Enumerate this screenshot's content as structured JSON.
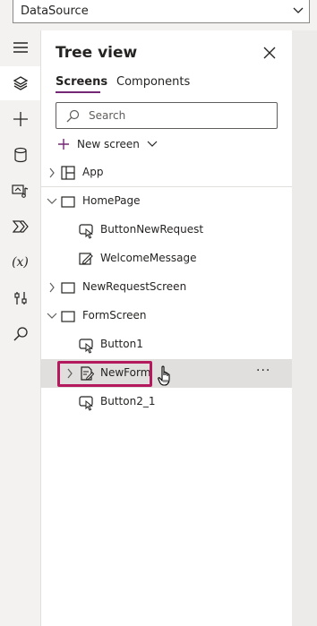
{
  "datasource": {
    "label": "DataSource"
  },
  "rail": {
    "items": [
      {
        "icon": "hamburger-menu-icon"
      },
      {
        "icon": "layers-icon",
        "active": true
      },
      {
        "icon": "plus-icon"
      },
      {
        "icon": "database-icon"
      },
      {
        "icon": "media-icon"
      },
      {
        "icon": "power-automate-icon"
      },
      {
        "icon": "variables-icon"
      },
      {
        "icon": "advanced-tools-icon"
      },
      {
        "icon": "search-icon"
      }
    ],
    "variables_label": "(x)"
  },
  "panel": {
    "title": "Tree view",
    "tabs": [
      {
        "label": "Screens",
        "active": true
      },
      {
        "label": "Components",
        "active": false
      }
    ],
    "search_placeholder": "Search",
    "new_screen_label": "New screen"
  },
  "tree": [
    {
      "label": "App",
      "indent": 0,
      "icon": "app-icon",
      "chevron": "right"
    },
    {
      "label": "HomePage",
      "indent": 0,
      "icon": "screen-icon",
      "chevron": "down"
    },
    {
      "label": "ButtonNewRequest",
      "indent": 1,
      "icon": "button-icon",
      "chevron": ""
    },
    {
      "label": "WelcomeMessage",
      "indent": 1,
      "icon": "text-edit-icon",
      "chevron": ""
    },
    {
      "label": "NewRequestScreen",
      "indent": 0,
      "icon": "screen-icon",
      "chevron": "right"
    },
    {
      "label": "FormScreen",
      "indent": 0,
      "icon": "screen-icon",
      "chevron": "down"
    },
    {
      "label": "Button1",
      "indent": 1,
      "icon": "button-icon",
      "chevron": ""
    },
    {
      "label": "NewForm",
      "indent": 1,
      "icon": "form-icon",
      "chevron": "right",
      "selected": true
    },
    {
      "label": "Button2_1",
      "indent": 1,
      "icon": "button-icon",
      "chevron": ""
    }
  ],
  "more_label": "···",
  "colors": {
    "accent": "#742774",
    "highlight": "#b4195d",
    "selected_row": "#e1dfdd"
  }
}
